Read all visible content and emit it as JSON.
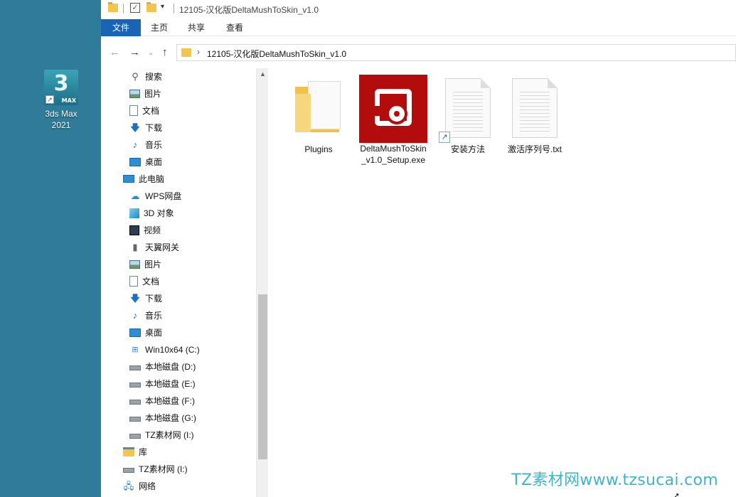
{
  "desktop": {
    "icon_label_line1": "3ds Max",
    "icon_label_line2": "2021",
    "logo_digit": "3",
    "logo_text": "MAX"
  },
  "window": {
    "title": "12105-汉化版DeltaMushToSkin_v1.0"
  },
  "ribbon": {
    "tabs": [
      "文件",
      "主页",
      "共享",
      "查看"
    ]
  },
  "address": {
    "path": "12105-汉化版DeltaMushToSkin_v1.0"
  },
  "nav_pane": {
    "items": [
      {
        "label": "搜索",
        "icon": "search-icon"
      },
      {
        "label": "图片",
        "icon": "pictures-icon"
      },
      {
        "label": "文档",
        "icon": "documents-icon"
      },
      {
        "label": "下载",
        "icon": "download-icon"
      },
      {
        "label": "音乐",
        "icon": "music-icon"
      },
      {
        "label": "桌面",
        "icon": "desktop-icon"
      },
      {
        "label": "此电脑",
        "icon": "pc-icon"
      },
      {
        "label": "WPS网盘",
        "icon": "cloud-icon"
      },
      {
        "label": "3D 对象",
        "icon": "3d-objects-icon"
      },
      {
        "label": "视频",
        "icon": "video-icon"
      },
      {
        "label": "天翼网关",
        "icon": "gateway-icon"
      },
      {
        "label": "图片",
        "icon": "pictures-icon"
      },
      {
        "label": "文档",
        "icon": "documents-icon"
      },
      {
        "label": "下载",
        "icon": "download-icon"
      },
      {
        "label": "音乐",
        "icon": "music-icon"
      },
      {
        "label": "桌面",
        "icon": "desktop-icon"
      },
      {
        "label": "Win10x64 (C:)",
        "icon": "windows-drive-icon"
      },
      {
        "label": "本地磁盘 (D:)",
        "icon": "drive-icon"
      },
      {
        "label": "本地磁盘 (E:)",
        "icon": "drive-icon"
      },
      {
        "label": "本地磁盘 (F:)",
        "icon": "drive-icon"
      },
      {
        "label": "本地磁盘 (G:)",
        "icon": "drive-icon"
      },
      {
        "label": "TZ素材网 (I:)",
        "icon": "drive-icon"
      },
      {
        "label": "库",
        "icon": "library-icon"
      },
      {
        "label": "TZ素材网 (I:)",
        "icon": "drive-icon"
      },
      {
        "label": "网络",
        "icon": "network-icon"
      }
    ]
  },
  "files": [
    {
      "name": "Plugins",
      "type": "folder"
    },
    {
      "name": "DeltaMushToSkin_v1.0_Setup.exe",
      "type": "exe"
    },
    {
      "name": "安装方法",
      "type": "shortcut"
    },
    {
      "name": "激活序列号.txt",
      "type": "text"
    }
  ],
  "watermark": "TZ素材网www.tzsucai.com",
  "icons": {
    "back": "back-arrow-icon",
    "forward": "forward-arrow-icon",
    "recent": "chevron-down-icon",
    "up": "up-arrow-icon"
  },
  "colors": {
    "desktop_bg": "#2f7c9a",
    "file_tab": "#1a64b5",
    "exe_red": "#b30c0c",
    "watermark": "#3fb3c9"
  }
}
